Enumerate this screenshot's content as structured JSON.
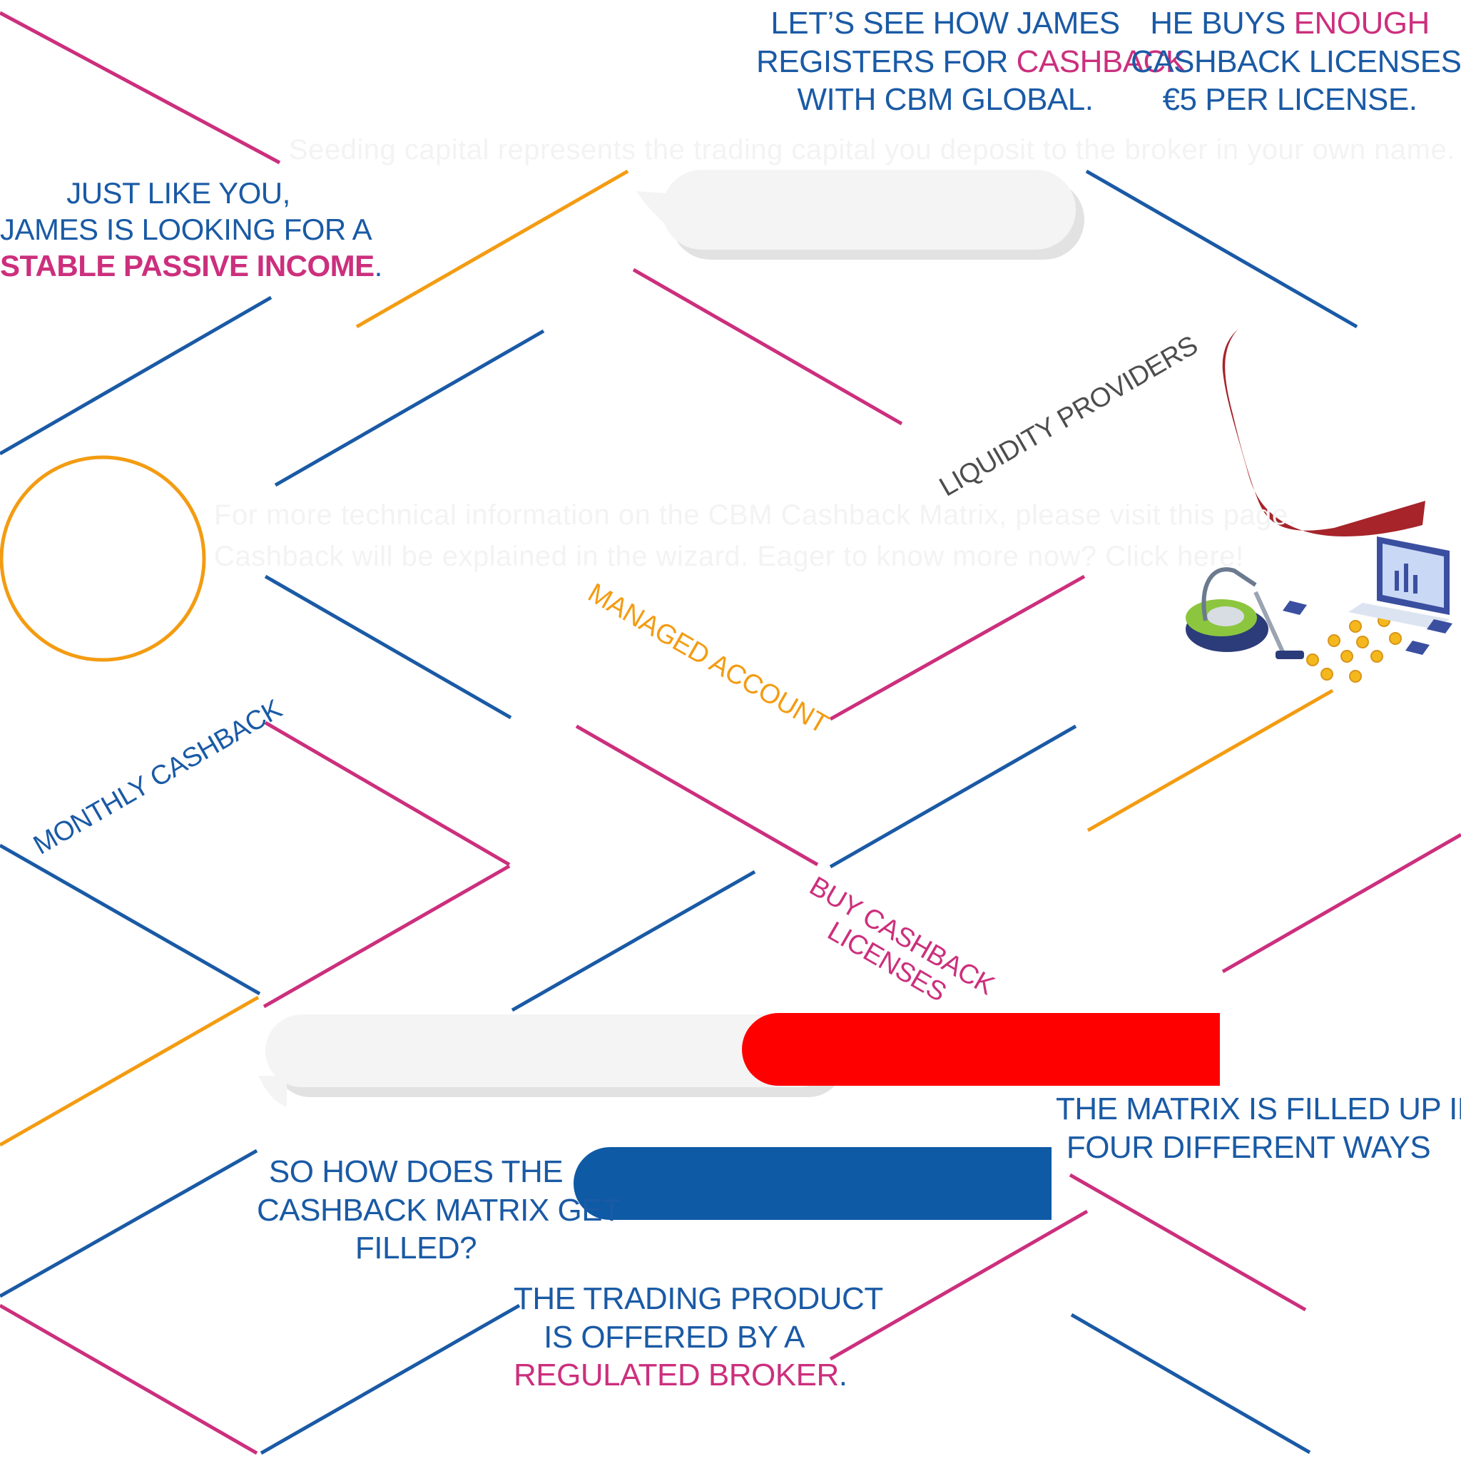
{
  "texts": {
    "james_intro": {
      "l1": "JUST LIKE YOU,",
      "l2": "JAMES IS LOOKING FOR A",
      "l3_highlight": "STABLE PASSIVE INCOME",
      "l3_end": "."
    },
    "registers": {
      "l1": "LET’S SEE HOW JAMES",
      "l2_a": "REGISTERS FOR ",
      "l2_highlight": "CASHBACK",
      "l3": "WITH CBM GLOBAL."
    },
    "buys": {
      "l1_a": "HE BUYS ",
      "l1_highlight": "ENOUGH",
      "l2": "CASHBACK LICENSES AT",
      "l3": "€5 PER LICENSE."
    },
    "liquidity": "LIQUIDITY PROVIDERS",
    "managed_account": "MANAGED ACCOUNT",
    "monthly_cashback": "MONTHLY CASHBACK",
    "buy_licenses": {
      "l1": "BUY CASHBACK",
      "l2": "LICENSES"
    },
    "matrix_four_ways": {
      "l1": "THE MATRIX IS FILLED UP IN",
      "l2": "FOUR DIFFERENT WAYS"
    },
    "how_filled": {
      "l1": "SO HOW DOES THE",
      "l2": "CASHBACK MATRIX GET",
      "l3": "FILLED?"
    },
    "regulated": {
      "l1": "THE TRADING PRODUCT",
      "l2": "IS OFFERED BY A",
      "l3_highlight": "REGULATED BROKER",
      "l3_end": "."
    },
    "ghost_capital": "Seeding capital represents the trading capital you deposit to the broker in your own name.",
    "ghost_info_l1": "For more technical information on the CBM Cashback Matrix, please visit this page.",
    "ghost_info_l2": "Cashback will be explained in the wizard. Eager to know more now? Click here!"
  },
  "icons": [
    "vacuum-cleaner-icon",
    "coins-icon",
    "laptop-chart-icon",
    "circle-ring-icon",
    "red-swoosh-icon"
  ],
  "colors": {
    "blue": "#1a5aa5",
    "pink": "#cc2f7d",
    "orange": "#f39c12",
    "red": "#ff0000",
    "pill_blue": "#0e5aa5",
    "swoosh": "#a6242a"
  }
}
